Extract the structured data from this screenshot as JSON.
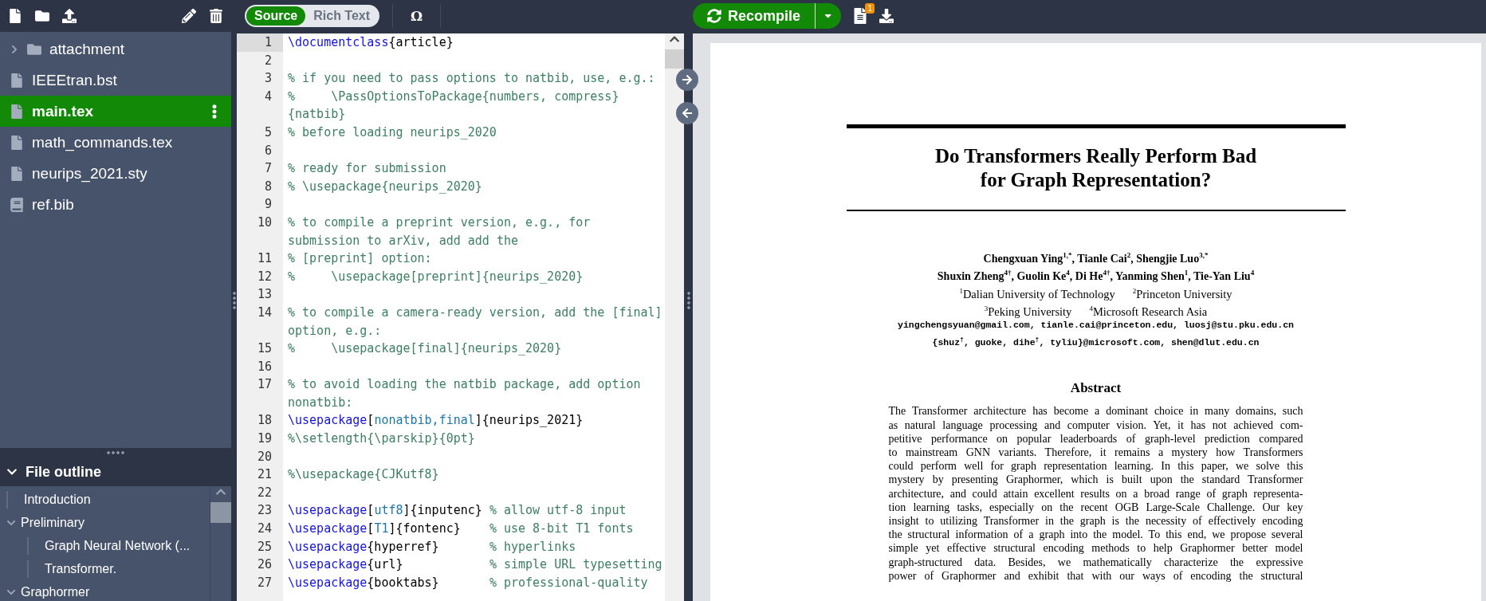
{
  "file_tree": [
    {
      "name": "attachment",
      "kind": "folder",
      "expanded": false,
      "selected": false
    },
    {
      "name": "IEEEtran.bst",
      "kind": "file",
      "selected": false
    },
    {
      "name": "main.tex",
      "kind": "file",
      "selected": true
    },
    {
      "name": "math_commands.tex",
      "kind": "file",
      "selected": false
    },
    {
      "name": "neurips_2021.sty",
      "kind": "file",
      "selected": false
    },
    {
      "name": "ref.bib",
      "kind": "bib",
      "selected": false
    }
  ],
  "file_outline": {
    "title": "File outline",
    "expanded": true,
    "items": [
      {
        "label": "Introduction"
      },
      {
        "label": "Preliminary",
        "expanded": true,
        "children": [
          {
            "label": "Graph Neural Network (..."
          },
          {
            "label": "Transformer."
          }
        ]
      },
      {
        "label": "Graphormer",
        "expanded": true
      }
    ]
  },
  "editor_mode": [
    {
      "label": "Source",
      "selected": true
    },
    {
      "label": "Rich Text",
      "selected": false
    }
  ],
  "symbol_button": "Ω",
  "recompile": {
    "label": "Recompile"
  },
  "logs_badge": "1",
  "editor": {
    "lines": [
      {
        "number": "1",
        "active": true,
        "segments": [
          {
            "kind": "command",
            "text": "\\documentclass"
          },
          {
            "kind": "plain",
            "text": "{article}"
          }
        ]
      },
      {
        "number": "2",
        "active": false
      },
      {
        "number": "3",
        "active": false,
        "segments": [
          {
            "kind": "comment",
            "text": "% if you need to pass options to natbib, use, e.g.:"
          }
        ]
      },
      {
        "number": "4",
        "active": false,
        "segments": [
          {
            "kind": "comment",
            "text": "%     \\PassOptionsToPackage{numbers, compress}"
          }
        ]
      },
      {
        "active": false,
        "segments": [
          {
            "kind": "comment",
            "text": "{natbib}"
          }
        ]
      },
      {
        "number": "5",
        "active": false,
        "segments": [
          {
            "kind": "comment",
            "text": "% before loading neurips_2020"
          }
        ]
      },
      {
        "number": "6",
        "active": false
      },
      {
        "number": "7",
        "active": false,
        "segments": [
          {
            "kind": "comment",
            "text": "% ready for submission"
          }
        ]
      },
      {
        "number": "8",
        "active": false,
        "segments": [
          {
            "kind": "comment",
            "text": "% \\usepackage{neurips_2020}"
          }
        ]
      },
      {
        "number": "9",
        "active": false
      },
      {
        "number": "10",
        "active": false,
        "segments": [
          {
            "kind": "comment",
            "text": "% to compile a preprint version, e.g., for"
          }
        ]
      },
      {
        "active": false,
        "segments": [
          {
            "kind": "comment",
            "text": "submission to arXiv, add add the"
          }
        ]
      },
      {
        "number": "11",
        "active": false,
        "segments": [
          {
            "kind": "comment",
            "text": "% [preprint] option:"
          }
        ]
      },
      {
        "number": "12",
        "active": false,
        "segments": [
          {
            "kind": "comment",
            "text": "%     \\usepackage[preprint]{neurips_2020}"
          }
        ]
      },
      {
        "number": "13",
        "active": false
      },
      {
        "number": "14",
        "active": false,
        "segments": [
          {
            "kind": "comment",
            "text": "% to compile a camera-ready version, add the [final]"
          }
        ]
      },
      {
        "active": false,
        "segments": [
          {
            "kind": "comment",
            "text": "option, e.g.:"
          }
        ]
      },
      {
        "number": "15",
        "active": false,
        "segments": [
          {
            "kind": "comment",
            "text": "%     \\usepackage[final]{neurips_2020}"
          }
        ]
      },
      {
        "number": "16",
        "active": false
      },
      {
        "number": "17",
        "active": false,
        "segments": [
          {
            "kind": "comment",
            "text": "% to avoid loading the natbib package, add option"
          }
        ]
      },
      {
        "active": false,
        "segments": [
          {
            "kind": "comment",
            "text": "nonatbib:"
          }
        ]
      },
      {
        "number": "18",
        "active": false,
        "segments": [
          {
            "kind": "command",
            "text": "\\usepackage"
          },
          {
            "kind": "plain",
            "text": "["
          },
          {
            "kind": "option",
            "text": "nonatbib,final"
          },
          {
            "kind": "plain",
            "text": "]{neurips_2021}"
          }
        ]
      },
      {
        "number": "19",
        "active": false,
        "segments": [
          {
            "kind": "comment",
            "text": "%\\setlength{\\parskip}{0pt}"
          }
        ]
      },
      {
        "number": "20",
        "active": false
      },
      {
        "number": "21",
        "active": false,
        "segments": [
          {
            "kind": "comment",
            "text": "%\\usepackage{CJKutf8}"
          }
        ]
      },
      {
        "number": "22",
        "active": false
      },
      {
        "number": "23",
        "active": false,
        "segments": [
          {
            "kind": "command",
            "text": "\\usepackage"
          },
          {
            "kind": "plain",
            "text": "["
          },
          {
            "kind": "option",
            "text": "utf8"
          },
          {
            "kind": "plain",
            "text": "]{inputenc} "
          },
          {
            "kind": "comment",
            "text": "% allow utf-8 input"
          }
        ]
      },
      {
        "number": "24",
        "active": false,
        "segments": [
          {
            "kind": "command",
            "text": "\\usepackage"
          },
          {
            "kind": "plain",
            "text": "["
          },
          {
            "kind": "option",
            "text": "T1"
          },
          {
            "kind": "plain",
            "text": "]{fontenc}    "
          },
          {
            "kind": "comment",
            "text": "% use 8-bit T1 fonts"
          }
        ]
      },
      {
        "number": "25",
        "active": false,
        "segments": [
          {
            "kind": "command",
            "text": "\\usepackage"
          },
          {
            "kind": "plain",
            "text": "{hyperref}       "
          },
          {
            "kind": "comment",
            "text": "% hyperlinks"
          }
        ]
      },
      {
        "number": "26",
        "active": false,
        "segments": [
          {
            "kind": "command",
            "text": "\\usepackage"
          },
          {
            "kind": "plain",
            "text": "{url}            "
          },
          {
            "kind": "comment",
            "text": "% simple URL typesetting"
          }
        ]
      },
      {
        "number": "27",
        "active": false,
        "segments": [
          {
            "kind": "command",
            "text": "\\usepackage"
          },
          {
            "kind": "plain",
            "text": "{booktabs}       "
          },
          {
            "kind": "comment",
            "text": "% professional-quality"
          }
        ]
      }
    ]
  },
  "pdf": {
    "title_lines": [
      "Do Transformers Really Perform Bad",
      "for Graph Representation?"
    ],
    "authors": [
      "Chengxuan Ying$^{1,*}$, Tianle Cai$^{2}$, Shengjie Luo$^{3,*}$",
      "Shuxin Zheng$^{4†}$, Guolin Ke$^{4}$, Di He$^{4†}$, Yanming Shen$^{1}$, Tie-Yan Liu$^{4}$"
    ],
    "affiliations": [
      [
        "$^{1}$Dalian University of Technology",
        "$^{2}$Princeton University"
      ],
      [
        "$^{3}$Peking University",
        "$^{4}$Microsoft Research Asia"
      ]
    ],
    "emails": [
      "yingchengsyuan@gmail.com, tianle.cai@princeton.edu, luosj@stu.pku.edu.cn",
      "{shuz$^{†}$, guoke, dihe$^{†}$, tyliu}@microsoft.com, shen@dlut.edu.cn"
    ],
    "abstract_heading": "Abstract",
    "abstract_lines": [
      "The Transformer architecture has become a dominant choice in many domains, such",
      "as natural language processing and computer vision. Yet, it has not achieved com-",
      "petitive performance on popular leaderboards of graph-level prediction compared",
      "to mainstream GNN variants. Therefore, it remains a mystery how Transformers",
      "could perform well for graph representation learning. In this paper, we solve this",
      "mystery by presenting Graphormer, which is built upon the standard Transformer",
      "architecture, and could attain excellent results on a broad range of graph representa-",
      "tion learning tasks, especially on the recent OGB Large-Scale Challenge. Our key",
      "insight to utilizing Transformer in the graph is the necessity of effectively encoding",
      "the structural information of a graph into the model. To this end, we propose several",
      "simple yet effective structural encoding methods to help Graphormer better model",
      "graph-structured data.  Besides, we mathematically characterize the expressive",
      "power of Graphormer and exhibit that with our ways of encoding the structural"
    ]
  }
}
